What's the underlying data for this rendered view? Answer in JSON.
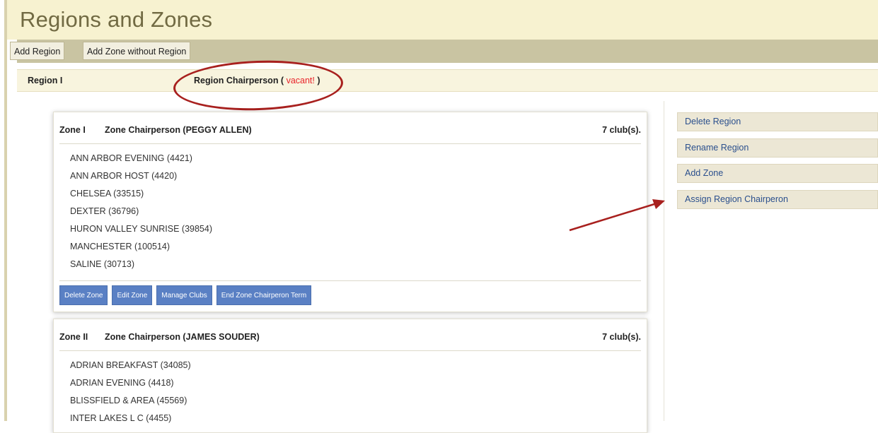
{
  "page": {
    "title": "Regions and Zones"
  },
  "toolbar": {
    "add_region": "Add Region",
    "add_zone_without_region": "Add Zone without Region"
  },
  "region": {
    "name": "Region I",
    "chair_prefix": "Region Chairperson (",
    "chair_status": "vacant!",
    "chair_suffix": ")"
  },
  "zones": [
    {
      "name": "Zone I",
      "chair": "Zone Chairperson (PEGGY ALLEN)",
      "club_count": "7 club(s).",
      "clubs": [
        "ANN ARBOR EVENING (4421)",
        "ANN ARBOR HOST (4420)",
        "CHELSEA (33515)",
        "DEXTER (36796)",
        "HURON VALLEY SUNRISE (39854)",
        "MANCHESTER (100514)",
        "SALINE (30713)"
      ],
      "actions": {
        "delete": "Delete Zone",
        "edit": "Edit Zone",
        "manage": "Manage Clubs",
        "end_term": "End Zone Chairperon Term"
      }
    },
    {
      "name": "Zone II",
      "chair": "Zone Chairperson (JAMES SOUDER)",
      "club_count": "7 club(s).",
      "clubs": [
        "ADRIAN BREAKFAST (34085)",
        "ADRIAN EVENING (4418)",
        "BLISSFIELD & AREA (45569)",
        "INTER LAKES L C (4455)"
      ]
    }
  ],
  "side_actions": {
    "delete_region": "Delete Region",
    "rename_region": "Rename Region",
    "add_zone": "Add Zone",
    "assign_chair": "Assign Region Chairperon"
  },
  "colors": {
    "title_bg": "#f7f2d0",
    "toolbar_bg": "#c9c4a2",
    "zone_button": "#5a80c4",
    "vacant_text": "#e8232a",
    "annotation": "#a8201e"
  }
}
